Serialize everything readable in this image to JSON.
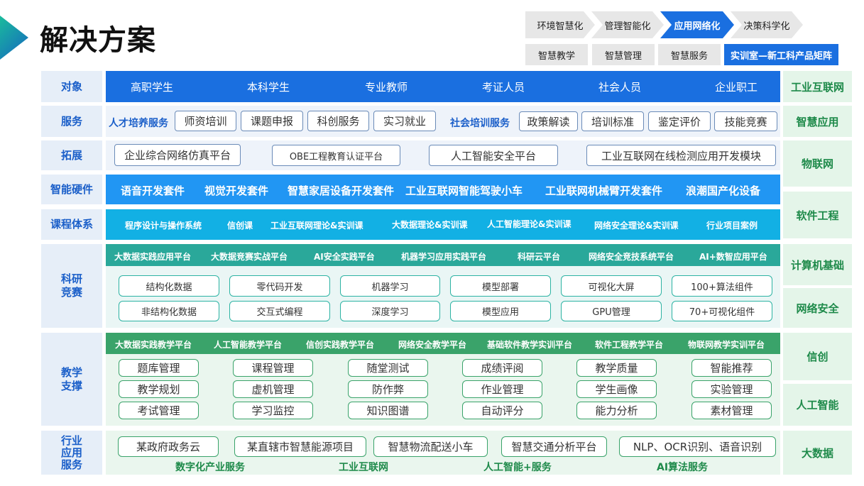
{
  "title": "解决方案",
  "stages": [
    "环境智慧化",
    "管理智能化",
    "应用网络化",
    "决策科学化"
  ],
  "subtabs": [
    "智慧教学",
    "智慧管理",
    "智慧服务",
    "实训室—新工科产品矩阵"
  ],
  "rows": {
    "target": {
      "label": "对象",
      "items": [
        "高职学生",
        "本科学生",
        "专业教师",
        "考证人员",
        "社会人员",
        "企业职工"
      ]
    },
    "service": {
      "label": "服务",
      "g1": "人才培养服务",
      "g1_items": [
        "师资培训",
        "课题申报",
        "科创服务",
        "实习就业"
      ],
      "g2": "社会培训服务",
      "g2_items": [
        "政策解读",
        "培训标准",
        "鉴定评价",
        "技能竞赛"
      ]
    },
    "expand": {
      "label": "拓展",
      "items": [
        "企业综合网络仿真平台",
        "OBE工程教育认证平台",
        "人工智能安全平台",
        "工业互联网在线检测应用开发模块"
      ]
    },
    "hardware": {
      "label": "智能硬件",
      "items": [
        "语音开发套件",
        "视觉开发套件",
        "智慧家居设备开发套件",
        "工业互联网智能驾驶小车",
        "工业联网机械臂开发套件",
        "浪潮国产化设备"
      ]
    },
    "course": {
      "label": "课程体系",
      "items": [
        "程序设计与操作系统",
        "信创课",
        "工业互联网理论&实训课",
        "大数据理论&实训课",
        "人工智能理论&实训课",
        "网络安全理论&实训课",
        "行业项目案例"
      ]
    },
    "research": {
      "label1": "科研",
      "label2": "竞赛",
      "platforms": [
        "大数据实践应用平台",
        "大数据竞赛实战平台",
        "AI安全实践平台",
        "机器学习应用实践平台",
        "科研云平台",
        "网络安全竞技系统平台",
        "AI+数智应用平台"
      ],
      "r1": [
        "结构化数据",
        "零代码开发",
        "机器学习",
        "模型部署",
        "可视化大屏",
        "100+算法组件"
      ],
      "r2": [
        "非结构化数据",
        "交互式编程",
        "深度学习",
        "模型应用",
        "GPU管理",
        "70+可视化组件"
      ]
    },
    "teaching": {
      "label1": "教学",
      "label2": "支撑",
      "platforms": [
        "大数据实践教学平台",
        "人工智能教学平台",
        "信创实践教学平台",
        "网络安全教学平台",
        "基础软件教学实训平台",
        "软件工程教学平台",
        "物联网教学实训平台"
      ],
      "r1": [
        "题库管理",
        "课程管理",
        "随堂测试",
        "成绩评阅",
        "教学质量",
        "智能推荐"
      ],
      "r2": [
        "教学规划",
        "虚机管理",
        "防作弊",
        "作业管理",
        "学生画像",
        "实验管理"
      ],
      "r3": [
        "考试管理",
        "学习监控",
        "知识图谱",
        "自动评分",
        "能力分析",
        "素材管理"
      ]
    },
    "industry": {
      "label1": "行业",
      "label2": "应用",
      "label3": "服务",
      "items": [
        "某政府政务云",
        "某直辖市智慧能源项目",
        "智慧物流配送小车",
        "智慧交通分析平台",
        "NLP、OCR识别、语音识别"
      ],
      "footer": [
        "数字化产业服务",
        "工业互联网",
        "人工智能+服务",
        "AI算法服务"
      ]
    }
  },
  "right": [
    "工业互联网",
    "智慧应用",
    "物联网",
    "软件工程",
    "计算机基础",
    "网络安全",
    "信创",
    "人工智能",
    "大数据"
  ],
  "colors": {
    "blue": "#1a6fe0",
    "band_hw": "#2196f3",
    "band_course": "#12b0e4",
    "teal": "#2aa89a",
    "green": "#3aa36a",
    "label_bg": "#e6eef8",
    "right_bg": "#e4f5e9"
  }
}
